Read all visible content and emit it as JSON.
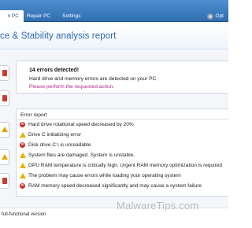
{
  "nav": {
    "tabs": [
      "n PC",
      "Repair PC",
      "Settings"
    ],
    "options_label": "Opt"
  },
  "header": {
    "title": "ce & Stability analysis report"
  },
  "alert": {
    "heading": "14 errors detected!",
    "body": "Hard drive and memory errors are detected on your PC.",
    "link": "Please perform the requested action."
  },
  "report": {
    "heading": "Error report",
    "items": [
      {
        "type": "error",
        "text": "Hard drive rotational speed decreased by 20%"
      },
      {
        "type": "warning",
        "text": "Drive C initializing error"
      },
      {
        "type": "error",
        "text": "Disk drive C:\\ is unreadable"
      },
      {
        "type": "warning",
        "text": "System files are damaged. System is unstable."
      },
      {
        "type": "warning",
        "text": "GPU RAM temperature is critically high. Urgent RAM memory optimization is required"
      },
      {
        "type": "warning",
        "text": "The problem may cause errors while loading your operating system"
      },
      {
        "type": "error",
        "text": "RAM memory speed decreased significantly and may cause a system failure"
      }
    ]
  },
  "footer": {
    "text": "full-functional version"
  },
  "watermark": "MalwareTips.com",
  "colors": {
    "nav_blue": "#2f6eb0",
    "title_blue": "#2c69ad",
    "error_red": "#cf2f2f",
    "warning_yellow": "#e9b200",
    "link_magenta": "#b0298b"
  }
}
